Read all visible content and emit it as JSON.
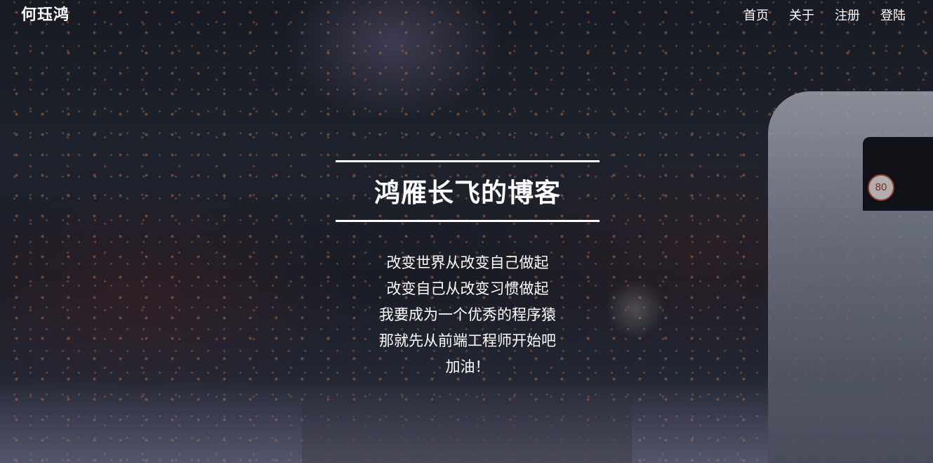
{
  "navbar": {
    "brand": "何珏鸿",
    "links": [
      "首页",
      "关于",
      "注册",
      "登陆"
    ]
  },
  "hero": {
    "title": "鸿雁长飞的博客",
    "lines": [
      "改变世界从改变自己做起",
      "改变自己从改变习惯做起",
      "我要成为一个优秀的程序猿",
      "那就先从前端工程师开始吧",
      "加油！"
    ]
  },
  "background": {
    "bus_sign": "80"
  },
  "colors": {
    "text": "#ffffff",
    "light_accent": "#ff9650"
  }
}
